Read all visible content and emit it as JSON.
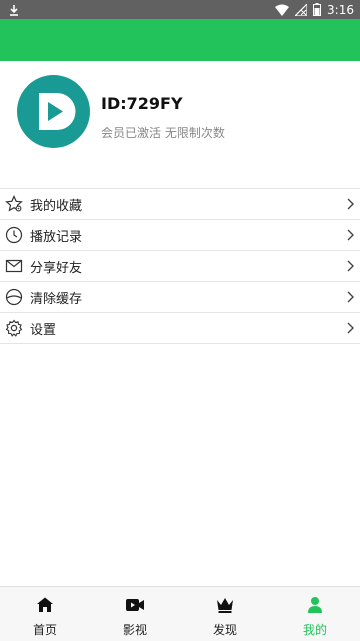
{
  "status_bar": {
    "time": "3:16"
  },
  "profile": {
    "id_text": "ID:729FY",
    "member_status": "会员已激活 无限制次数"
  },
  "menu": [
    {
      "label": "我的收藏",
      "icon": "favorites-settings-icon"
    },
    {
      "label": "播放记录",
      "icon": "clock-icon"
    },
    {
      "label": "分享好友",
      "icon": "mail-icon"
    },
    {
      "label": "清除缓存",
      "icon": "clear-cache-icon"
    },
    {
      "label": "设置",
      "icon": "gear-icon"
    }
  ],
  "bottom_nav": [
    {
      "label": "首页",
      "icon": "home-icon",
      "active": false
    },
    {
      "label": "影视",
      "icon": "video-icon",
      "active": false
    },
    {
      "label": "发现",
      "icon": "crown-icon",
      "active": false
    },
    {
      "label": "我的",
      "icon": "person-icon",
      "active": true
    }
  ],
  "colors": {
    "accent": "#21c35a",
    "avatar": "#1a9a94",
    "status_bar": "#616161"
  }
}
